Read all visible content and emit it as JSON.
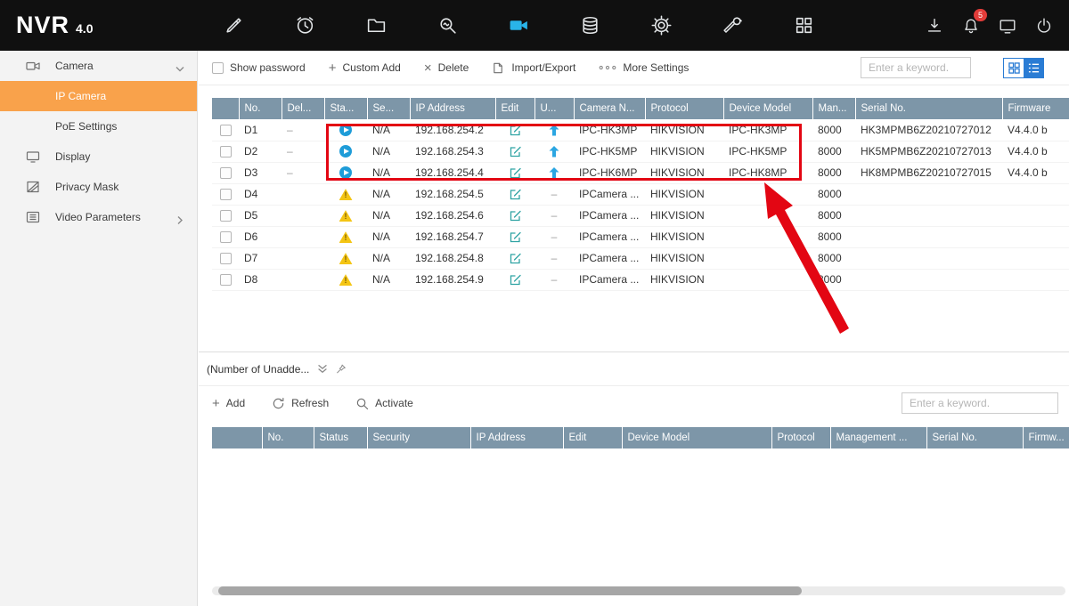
{
  "topbar": {
    "logo": "NVR",
    "version": "4.0",
    "nav_icons": [
      "tools",
      "playback",
      "file-management",
      "smart-analysis",
      "camera",
      "storage",
      "system-config",
      "maintenance",
      "more-modules"
    ],
    "right_icons": [
      "download",
      "alarm-bell",
      "screen",
      "power"
    ],
    "alarm_badge": "5"
  },
  "colors": {
    "accent_orange": "#f9a24b",
    "table_header": "#7d96a8",
    "active_icon_blue": "#29b4e9",
    "annotation_red": "#e30613"
  },
  "sidebar": {
    "items": [
      {
        "label": "Camera",
        "icon": "camera",
        "chevron": "down",
        "active": false,
        "sub": false
      },
      {
        "label": "IP Camera",
        "icon": "",
        "chevron": "",
        "active": true,
        "sub": true
      },
      {
        "label": "PoE Settings",
        "icon": "",
        "chevron": "",
        "active": false,
        "sub": true
      },
      {
        "label": "Display",
        "icon": "display",
        "chevron": "",
        "active": false,
        "sub": false
      },
      {
        "label": "Privacy Mask",
        "icon": "privacy-mask",
        "chevron": "",
        "active": false,
        "sub": false
      },
      {
        "label": "Video Parameters",
        "icon": "video-parameters",
        "chevron": "right",
        "active": false,
        "sub": false
      }
    ]
  },
  "toolbar": {
    "show_password": "Show password",
    "custom_add": "Custom Add",
    "delete": "Delete",
    "import_export": "Import/Export",
    "more_settings": "More Settings",
    "search_placeholder": "Enter a keyword."
  },
  "table": {
    "headers": [
      "",
      "No.",
      "Del...",
      "Sta...",
      "Se...",
      "IP Address",
      "Edit",
      "U...",
      "Camera N...",
      "Protocol",
      "Device Model",
      "Man...",
      "Serial No.",
      "Firmware"
    ],
    "rows": [
      {
        "no": "D1",
        "del": "–",
        "status": "online",
        "security": "N/A",
        "ip": "192.168.254.2",
        "edit": true,
        "upgrade": "up",
        "camera": "IPC-HK3MP",
        "protocol": "HIKVISION",
        "model": "IPC-HK3MP",
        "mgmt": "8000",
        "serial": "HK3MPMB6Z20210727012",
        "firmware": "V4.4.0 b"
      },
      {
        "no": "D2",
        "del": "–",
        "status": "online",
        "security": "N/A",
        "ip": "192.168.254.3",
        "edit": true,
        "upgrade": "up",
        "camera": "IPC-HK5MP",
        "protocol": "HIKVISION",
        "model": "IPC-HK5MP",
        "mgmt": "8000",
        "serial": "HK5MPMB6Z20210727013",
        "firmware": "V4.4.0 b"
      },
      {
        "no": "D3",
        "del": "–",
        "status": "online",
        "security": "N/A",
        "ip": "192.168.254.4",
        "edit": true,
        "upgrade": "up",
        "camera": "IPC-HK6MP",
        "protocol": "HIKVISION",
        "model": "IPC-HK8MP",
        "mgmt": "8000",
        "serial": "HK8MPMB6Z20210727015",
        "firmware": "V4.4.0 b"
      },
      {
        "no": "D4",
        "del": "",
        "status": "warning",
        "security": "N/A",
        "ip": "192.168.254.5",
        "edit": true,
        "upgrade": "–",
        "camera": "IPCamera ...",
        "protocol": "HIKVISION",
        "model": "",
        "mgmt": "8000",
        "serial": "",
        "firmware": ""
      },
      {
        "no": "D5",
        "del": "",
        "status": "warning",
        "security": "N/A",
        "ip": "192.168.254.6",
        "edit": true,
        "upgrade": "–",
        "camera": "IPCamera ...",
        "protocol": "HIKVISION",
        "model": "",
        "mgmt": "8000",
        "serial": "",
        "firmware": ""
      },
      {
        "no": "D6",
        "del": "",
        "status": "warning",
        "security": "N/A",
        "ip": "192.168.254.7",
        "edit": true,
        "upgrade": "–",
        "camera": "IPCamera ...",
        "protocol": "HIKVISION",
        "model": "",
        "mgmt": "8000",
        "serial": "",
        "firmware": ""
      },
      {
        "no": "D7",
        "del": "",
        "status": "warning",
        "security": "N/A",
        "ip": "192.168.254.8",
        "edit": true,
        "upgrade": "–",
        "camera": "IPCamera ...",
        "protocol": "HIKVISION",
        "model": "",
        "mgmt": "8000",
        "serial": "",
        "firmware": ""
      },
      {
        "no": "D8",
        "del": "",
        "status": "warning",
        "security": "N/A",
        "ip": "192.168.254.9",
        "edit": true,
        "upgrade": "–",
        "camera": "IPCamera ...",
        "protocol": "HIKVISION",
        "model": "",
        "mgmt": "8000",
        "serial": "",
        "firmware": ""
      }
    ]
  },
  "bottom_panel": {
    "title": "(Number of Unadde...",
    "add": "Add",
    "refresh": "Refresh",
    "activate": "Activate",
    "search_placeholder": "Enter a keyword.",
    "headers": [
      "",
      "No.",
      "Status",
      "Security",
      "IP Address",
      "Edit",
      "Device Model",
      "Protocol",
      "Management ...",
      "Serial No.",
      "Firmw..."
    ]
  }
}
